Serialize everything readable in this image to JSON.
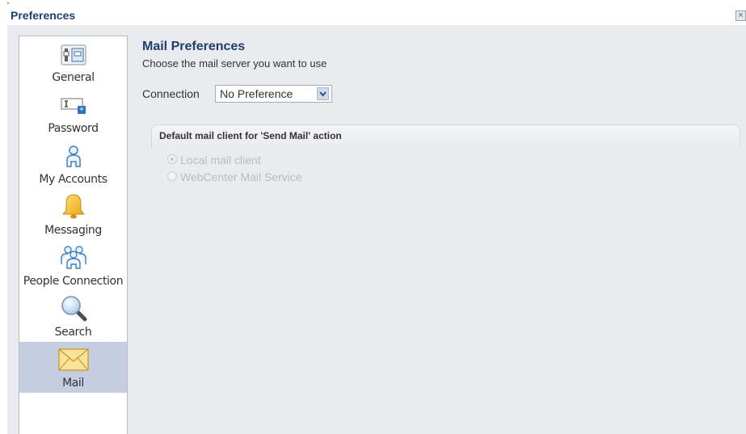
{
  "window": {
    "title": "Preferences",
    "close_icon": "close-icon"
  },
  "sidebar": {
    "selected": "Mail",
    "items": [
      {
        "label": "General",
        "icon": "general-settings-icon"
      },
      {
        "label": "Password",
        "icon": "password-field-icon"
      },
      {
        "label": "My Accounts",
        "icon": "user-account-icon"
      },
      {
        "label": "Messaging",
        "icon": "bell-icon"
      },
      {
        "label": "People Connection",
        "icon": "people-group-icon"
      },
      {
        "label": "Search",
        "icon": "magnifier-icon"
      },
      {
        "label": "Mail",
        "icon": "envelope-icon"
      }
    ]
  },
  "main": {
    "title": "Mail Preferences",
    "subtitle": "Choose the mail server you want to use",
    "connection": {
      "label": "Connection",
      "selected": "No Preference"
    },
    "group": {
      "header": "Default mail client for 'Send Mail' action",
      "options": [
        {
          "label": "Local mail client",
          "checked": true,
          "disabled": true
        },
        {
          "label": "WebCenter Mail Service",
          "checked": false,
          "disabled": true
        }
      ]
    }
  },
  "colors": {
    "title_blue": "#1f3f73",
    "panel_bg": "#eaebef",
    "selected_item_bg": "#c5cde0"
  }
}
